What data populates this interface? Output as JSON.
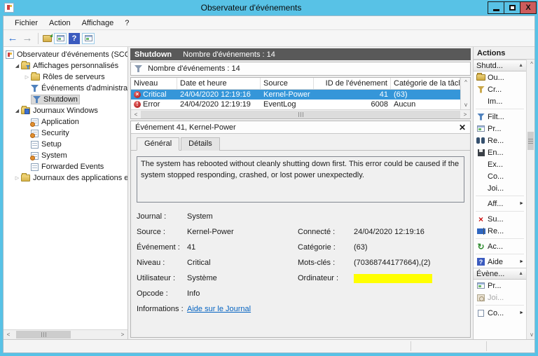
{
  "window": {
    "title": "Observateur d'événements",
    "close_glyph": "X"
  },
  "menu": {
    "items": [
      "Fichier",
      "Action",
      "Affichage",
      "?"
    ]
  },
  "toolbar": {
    "back_glyph": "←",
    "forward_glyph": "→",
    "help_glyph": "?"
  },
  "tree": {
    "items": [
      {
        "label": "Observateur d'événements (SCC",
        "icon": "event-viewer-icon"
      },
      {
        "label": "Affichages personnalisés",
        "icon": "custom-views-folder-icon",
        "expander": "◢"
      },
      {
        "label": "Rôles de serveurs",
        "icon": "folder-icon",
        "expander": "▷"
      },
      {
        "label": "Événements d'administrat",
        "icon": "filter-view-icon"
      },
      {
        "label": "Shutdown",
        "icon": "filter-view-icon",
        "selected": true
      },
      {
        "label": "Journaux Windows",
        "icon": "windows-logs-folder-icon",
        "expander": "◢"
      },
      {
        "label": "Application",
        "icon": "log-icon"
      },
      {
        "label": "Security",
        "icon": "log-icon"
      },
      {
        "label": "Setup",
        "icon": "log-icon"
      },
      {
        "label": "System",
        "icon": "log-icon"
      },
      {
        "label": "Forwarded Events",
        "icon": "log-icon"
      },
      {
        "label": "Journaux des applications et",
        "icon": "folder-icon",
        "expander": "▷"
      }
    ]
  },
  "main": {
    "darkbar": {
      "title": "Shutdown",
      "count_label": "Nombre d'événements : 14"
    },
    "filter_bar": {
      "label": "Nombre d'événements : 14"
    },
    "table": {
      "columns": [
        "Niveau",
        "Date et heure",
        "Source",
        "ID de l'événement",
        "Catégorie de la tâche"
      ],
      "rows": [
        {
          "level": "Critical",
          "severity_glyph": "×",
          "date": "24/04/2020 12:19:16",
          "source": "Kernel-Power",
          "event_id": "41",
          "category": "(63)",
          "selected": true
        },
        {
          "level": "Error",
          "severity_glyph": "!",
          "date": "24/04/2020 12:19:19",
          "source": "EventLog",
          "event_id": "6008",
          "category": "Aucun",
          "selected": false
        }
      ],
      "scroll": {
        "up": "^",
        "down": "v",
        "left": "<",
        "right": ">"
      }
    },
    "details": {
      "title": "Événement 41, Kernel-Power",
      "close_glyph": "✕",
      "tabs": [
        {
          "label": "Général"
        },
        {
          "label": "Détails"
        }
      ],
      "message": "The system has rebooted without cleanly shutting down first. This error could be caused if the system stopped responding, crashed, or lost power unexpectedly.",
      "fields": {
        "journal_label": "Journal :",
        "journal_value": "System",
        "source_label": "Source :",
        "source_value": "Kernel-Power",
        "connected_label": "Connecté :",
        "connected_value": "24/04/2020 12:19:16",
        "event_label": "Événement :",
        "event_value": "41",
        "category_label": "Catégorie :",
        "category_value": "(63)",
        "level_label": "Niveau :",
        "level_value": "Critical",
        "keywords_label": "Mots-clés :",
        "keywords_value": "(70368744177664),(2)",
        "user_label": "Utilisateur :",
        "user_value": "Système",
        "computer_label": "Ordinateur :",
        "computer_value": "",
        "computer_redacted": true,
        "opcode_label": "Opcode :",
        "opcode_value": "Info",
        "info_label": "Informations :",
        "info_link": "Aide sur le Journal"
      }
    }
  },
  "actions": {
    "title": "Actions",
    "collapse_glyph": "▲",
    "submenu_glyph": "►",
    "scroll": {
      "up": "^",
      "down": "v"
    },
    "sections": [
      {
        "header": "Shutd...",
        "items": [
          {
            "label": "Ou...",
            "icon": "open-saved-log-icon"
          },
          {
            "label": "Cr...",
            "icon": "create-custom-view-icon"
          },
          {
            "label": "Im..."
          },
          {
            "label": "Filt...",
            "icon": "filter-icon"
          },
          {
            "label": "Pr...",
            "icon": "properties-icon"
          },
          {
            "label": "Re...",
            "icon": "find-icon"
          },
          {
            "label": "En...",
            "icon": "save-icon"
          },
          {
            "label": "Ex..."
          },
          {
            "label": "Co..."
          },
          {
            "label": "Joi..."
          },
          {
            "label": "Aff...",
            "submenu": true
          },
          {
            "label": "Su...",
            "icon": "delete-icon"
          },
          {
            "label": "Re...",
            "icon": "rename-icon"
          },
          {
            "label": "Ac...",
            "icon": "refresh-icon"
          },
          {
            "label": "Aide",
            "icon": "help-icon",
            "submenu": true
          }
        ]
      },
      {
        "header": "Évène...",
        "items": [
          {
            "label": "Pr...",
            "icon": "properties-icon"
          },
          {
            "label": "Joi...",
            "icon": "attach-task-icon",
            "disabled": true
          },
          {
            "label": "Co...",
            "icon": "copy-icon",
            "submenu": true
          }
        ]
      }
    ]
  }
}
